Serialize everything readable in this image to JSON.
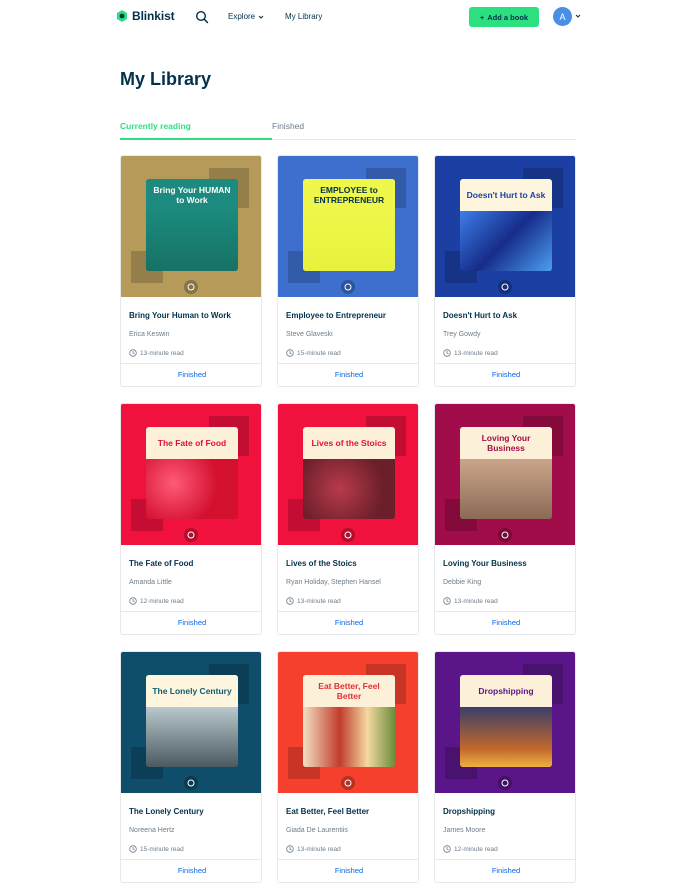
{
  "header": {
    "logo_text": "Blinkist",
    "explore_label": "Explore",
    "library_label": "My Library",
    "add_book_label": "Add a book",
    "avatar_initial": "A"
  },
  "page_title": "My Library",
  "tabs": [
    {
      "label": "Currently reading",
      "active": true
    },
    {
      "label": "Finished",
      "active": false
    }
  ],
  "colors": {
    "accent_green": "#2ce080",
    "link_blue": "#0365f2",
    "navy": "#03314b"
  },
  "books": [
    {
      "title": "Bring Your Human to Work",
      "author": "Erica Keswin",
      "read_time": "13-minute read",
      "status": "Finished",
      "cover_color": "#b59a5a",
      "cover_text": "Bring Your HUMAN to Work",
      "cover_author": "Erica Keswin"
    },
    {
      "title": "Employee to Entrepreneur",
      "author": "Steve Glaveski",
      "read_time": "15-minute read",
      "status": "Finished",
      "cover_color": "#3e6fcf",
      "cover_text": "EMPLOYEE to ENTREPRENEUR",
      "cover_author": "Steve Glaveski"
    },
    {
      "title": "Doesn't Hurt to Ask",
      "author": "Trey Gowdy",
      "read_time": "13-minute read",
      "status": "Finished",
      "cover_color": "#1c3fa3",
      "cover_text": "Doesn't Hurt to Ask"
    },
    {
      "title": "The Fate of Food",
      "author": "Amanda Little",
      "read_time": "12-minute read",
      "status": "Finished",
      "cover_color": "#f0113d",
      "cover_text": "The Fate of Food"
    },
    {
      "title": "Lives of the Stoics",
      "author": "Ryan Holiday, Stephen Hansel",
      "read_time": "13-minute read",
      "status": "Finished",
      "cover_color": "#f0113d",
      "cover_text": "Lives of the Stoics"
    },
    {
      "title": "Loving Your Business",
      "author": "Debbie King",
      "read_time": "13-minute read",
      "status": "Finished",
      "cover_color": "#a10d4a",
      "cover_text": "Loving Your Business"
    },
    {
      "title": "The Lonely Century",
      "author": "Noreena Hertz",
      "read_time": "15-minute read",
      "status": "Finished",
      "cover_color": "#0e4e6b",
      "cover_text": "The Lonely Century"
    },
    {
      "title": "Eat Better, Feel Better",
      "author": "Giada De Laurentiis",
      "read_time": "13-minute read",
      "status": "Finished",
      "cover_color": "#f5402e",
      "cover_text": "Eat Better, Feel Better"
    },
    {
      "title": "Dropshipping",
      "author": "James Moore",
      "read_time": "12-minute read",
      "status": "Finished",
      "cover_color": "#5a1688",
      "cover_text": "Dropshipping"
    }
  ]
}
